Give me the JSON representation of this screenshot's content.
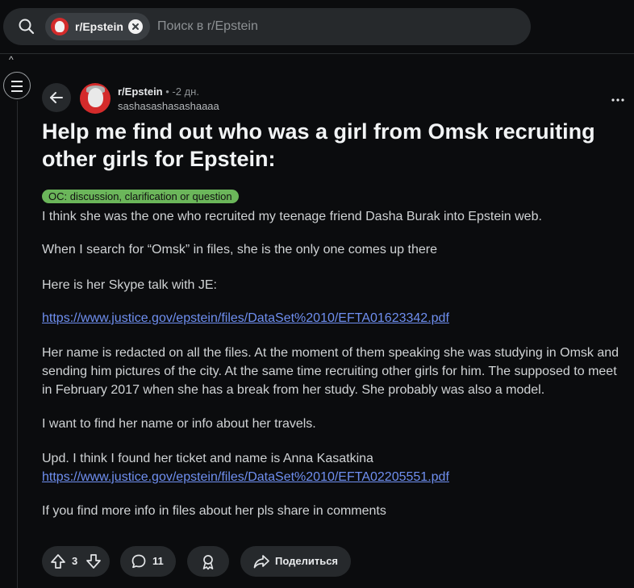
{
  "search": {
    "chip_label": "r/Epstein",
    "placeholder": "Поиск в r/Epstein"
  },
  "post": {
    "subreddit": "r/Epstein",
    "time": "• -2 дн.",
    "author": "sashasashasashaaaa",
    "title": "Help me find out who was a girl from Omsk recruiting other girls for Epstein:",
    "flair": "OC: discussion, clarification or question",
    "paragraphs": [
      "I think she was the one who recruited my teenage friend Dasha Burak into Epstein web.",
      "When I search for “Omsk” in files, she is the only one comes up there",
      "Here is her Skype talk with JE:",
      "https://www.justice.gov/epstein/files/DataSet%2010/EFTA01623342.pdf",
      "Her name is redacted on all the files. At the moment of them speaking she was studying in Omsk and sending him pictures of the city. At the same time recruiting other girls for him. The supposed to meet in February 2017 when she has a break from her study. She probably was also a model.",
      "I want to find her name or info about her travels.",
      "Upd. I think I found her ticket and name is Anna Kasatkina",
      "https://www.justice.gov/epstein/files/DataSet%2010/EFTA02205551.pdf",
      "If you find more info in files about her pls share in comments"
    ]
  },
  "actions": {
    "vote_count": "3",
    "comment_count": "11",
    "share_label": "Поделиться"
  },
  "colors": {
    "background": "#0b0c0e",
    "surface": "#26292c",
    "flair": "#6bb65a",
    "link": "#6f8ff0",
    "subreddit_icon": "#d42b2b"
  },
  "icons": [
    "search-icon",
    "close-icon",
    "menu-icon",
    "arrow-left-icon",
    "more-icon",
    "upvote-icon",
    "downvote-icon",
    "comment-icon",
    "award-icon",
    "share-icon"
  ]
}
